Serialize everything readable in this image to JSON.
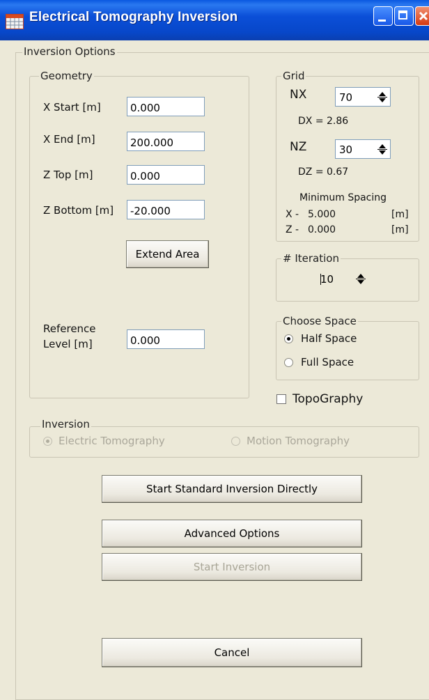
{
  "window": {
    "title": "Electrical Tomography Inversion",
    "icon": "grid-window-icon",
    "controls": [
      "minimize-icon",
      "maximize-icon",
      "close-icon"
    ]
  },
  "inversion_options": {
    "label": "Inversion Options",
    "geometry": {
      "label": "Geometry",
      "x_start": {
        "label": "X Start [m]",
        "value": "0.000"
      },
      "x_end": {
        "label": "X End [m]",
        "value": "200.000"
      },
      "z_top": {
        "label": "Z Top [m]",
        "value": "0.000"
      },
      "z_bottom": {
        "label": "Z Bottom [m]",
        "value": "-20.000"
      },
      "extend_area": "Extend Area",
      "reference_level": {
        "label_line1": "Reference",
        "label_line2": "Level [m]",
        "value": "0.000"
      }
    },
    "grid": {
      "label": "Grid",
      "nx": {
        "label": "NX",
        "value": "70"
      },
      "dx": "DX = 2.86",
      "nz": {
        "label": "NZ",
        "value": "30"
      },
      "dz": "DZ = 0.67",
      "min_spacing_label": "Minimum Spacing",
      "x_spacing": {
        "axis": "X -",
        "value": "5.000",
        "unit": "[m]"
      },
      "z_spacing": {
        "axis": "Z -",
        "value": "0.000",
        "unit": "[m]"
      }
    },
    "iteration": {
      "label": "# Iteration",
      "value": "10"
    },
    "choose_space": {
      "label": "Choose Space",
      "options": [
        {
          "label": "Half Space",
          "checked": true
        },
        {
          "label": "Full Space",
          "checked": false
        }
      ]
    },
    "topography": {
      "label": "TopoGraphy",
      "checked": false
    },
    "inversion": {
      "label": "Inversion",
      "options": [
        {
          "label": "Electric Tomography",
          "checked": true,
          "enabled": false
        },
        {
          "label": "Motion Tomography",
          "checked": false,
          "enabled": false
        }
      ]
    },
    "buttons": {
      "start_standard": "Start Standard Inversion Directly",
      "advanced": "Advanced Options",
      "start_inversion": "Start Inversion",
      "start_inversion_enabled": false,
      "cancel": "Cancel"
    }
  }
}
